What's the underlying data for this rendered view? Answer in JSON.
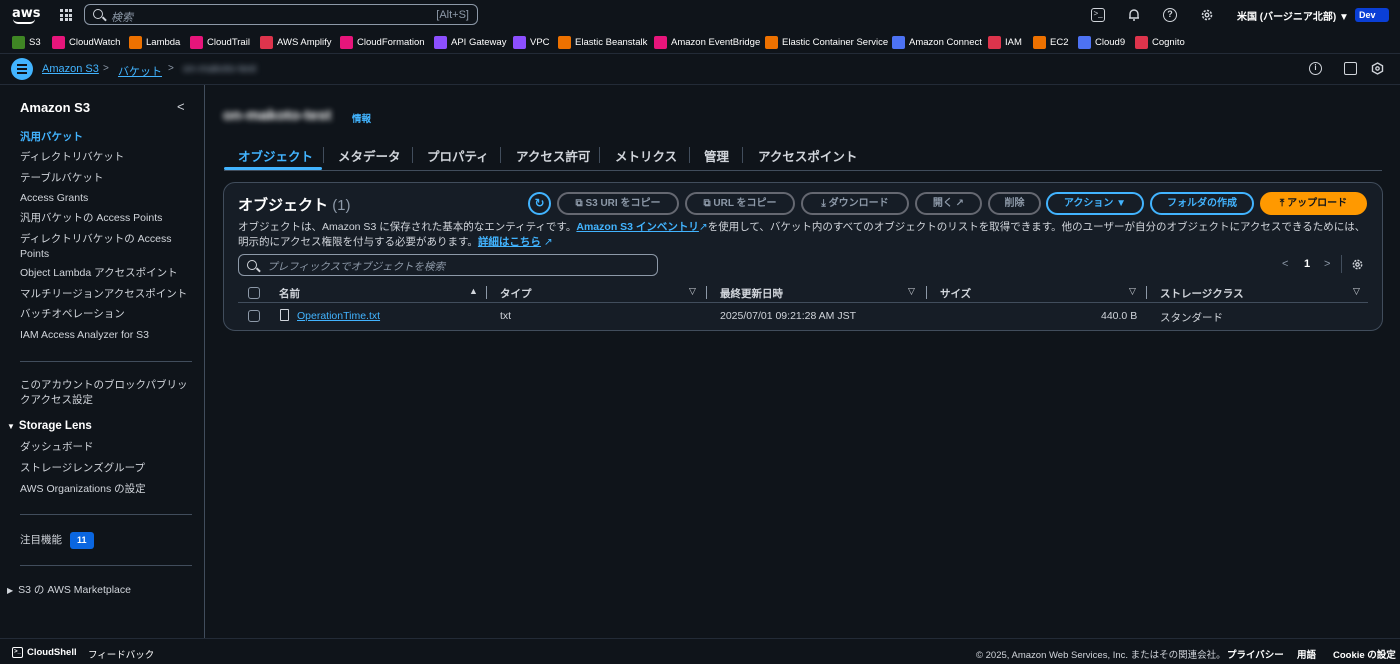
{
  "topnav": {
    "logo": "aws",
    "search_placeholder": "検索",
    "search_shortcut": "[Alt+S]",
    "region": "米国 (バージニア北部) ▼",
    "account": "Dev"
  },
  "favorites": [
    {
      "label": "S3",
      "color": "#3f8624"
    },
    {
      "label": "CloudWatch",
      "color": "#e7157b"
    },
    {
      "label": "Lambda",
      "color": "#ed7100"
    },
    {
      "label": "CloudTrail",
      "color": "#e7157b"
    },
    {
      "label": "AWS Amplify",
      "color": "#dd344c"
    },
    {
      "label": "CloudFormation",
      "color": "#e7157b"
    },
    {
      "label": "API Gateway",
      "color": "#8c4fff"
    },
    {
      "label": "VPC",
      "color": "#8c4fff"
    },
    {
      "label": "Elastic Beanstalk",
      "color": "#ed7100"
    },
    {
      "label": "Amazon EventBridge",
      "color": "#e7157b"
    },
    {
      "label": "Elastic Container Service",
      "color": "#ed7100"
    },
    {
      "label": "Amazon Connect",
      "color": "#4d72f3"
    },
    {
      "label": "IAM",
      "color": "#dd344c"
    },
    {
      "label": "EC2",
      "color": "#ed7100"
    },
    {
      "label": "Cloud9",
      "color": "#4d72f3"
    },
    {
      "label": "Cognito",
      "color": "#dd344c"
    }
  ],
  "breadcrumb": {
    "s3": "Amazon S3",
    "buckets": "バケット",
    "bucket_name": "on-makoto-test"
  },
  "sidebar": {
    "title": "Amazon S3",
    "items": [
      "汎用バケット",
      "ディレクトリバケット",
      "テーブルバケット",
      "Access Grants",
      "汎用バケットの Access Points",
      "ディレクトリバケットの Access Points",
      "Object Lambda アクセスポイント",
      "マルチリージョンアクセスポイント",
      "バッチオペレーション",
      "IAM Access Analyzer for S3"
    ],
    "block_public": "このアカウントのブロックパブリックアクセス設定",
    "storage_lens_head": "Storage Lens",
    "storage_lens_items": [
      "ダッシュボード",
      "ストレージレンズグループ",
      "AWS Organizations の設定"
    ],
    "featured": "注目機能",
    "featured_count": "11",
    "marketplace": "S3 の AWS Marketplace"
  },
  "main": {
    "bucket_title": "on-makoto-test",
    "info": "情報",
    "tabs": [
      "オブジェクト",
      "メタデータ",
      "プロパティ",
      "アクセス許可",
      "メトリクス",
      "管理",
      "アクセスポイント"
    ],
    "objects_title": "オブジェクト",
    "objects_count": "(1)",
    "buttons": {
      "copy_s3_uri": "S3 URI をコピー",
      "copy_url": "URL をコピー",
      "download": "ダウンロード",
      "open": "開く",
      "delete": "削除",
      "actions": "アクション ▼",
      "create_folder": "フォルダの作成",
      "upload": "アップロード"
    },
    "desc_1": "オブジェクトは、Amazon S3 に保存された基本的なエンティティです。",
    "desc_link": "Amazon S3 インベントリ",
    "desc_2": "を使用して、バケット内のすべてのオブジェクトのリストを取得できます。他のユーザーが自分のオブジェクトにアクセスできるためには、明示的にアクセス権限を付与する必要があります。",
    "desc_more": "詳細はこちら",
    "filter_placeholder": "プレフィックスでオブジェクトを検索",
    "page": "1",
    "columns": [
      "名前",
      "タイプ",
      "最終更新日時",
      "サイズ",
      "ストレージクラス"
    ],
    "rows": [
      {
        "name": "OperationTime.txt",
        "type": "txt",
        "modified": "2025/07/01 09:21:28 AM JST",
        "size": "440.0 B",
        "storage": "スタンダード"
      }
    ]
  },
  "footer": {
    "cloudshell": "CloudShell",
    "feedback": "フィードバック",
    "copyright": "© 2025, Amazon Web Services, Inc. またはその関連会社。",
    "privacy": "プライバシー",
    "terms": "用語",
    "cookie": "Cookie の設定"
  }
}
